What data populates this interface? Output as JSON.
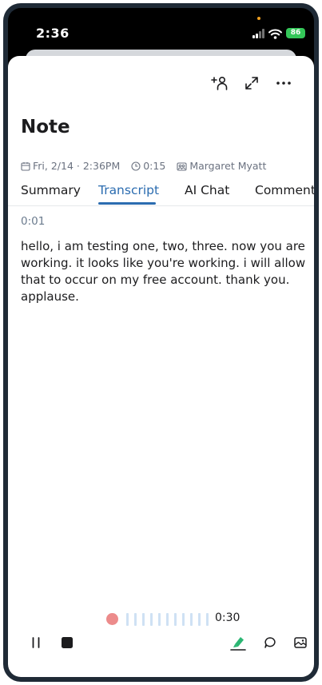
{
  "status_bar": {
    "time": "2:36",
    "battery": "86"
  },
  "note": {
    "title": "Note",
    "date": "Fri, 2/14 · 2:36PM",
    "duration": "0:15",
    "owner": "Margaret Myatt"
  },
  "tabs": [
    {
      "label": "Summary"
    },
    {
      "label": "Transcript"
    },
    {
      "label": "AI Chat"
    },
    {
      "label": "Comments"
    }
  ],
  "active_tab": "Transcript",
  "transcript": {
    "timestamp": "0:01",
    "text": "hello, i am testing one, two, three. now you are working. it looks like you're working. i will allow that to occur on my free account. thank you. applause."
  },
  "recorder": {
    "elapsed": "0:30"
  },
  "colors": {
    "accent": "#2b6cb0",
    "record": "#ec8b8b",
    "highlight": "#2bb673",
    "battery": "#34c759"
  },
  "icons": {
    "add_person": "add-person-icon",
    "expand": "expand-icon",
    "more": "more-icon",
    "calendar": "calendar-icon",
    "clock": "clock-icon",
    "people": "people-icon",
    "pause": "pause-icon",
    "stop": "stop-icon",
    "highlight": "highlighter-icon",
    "comment": "comment-icon",
    "image": "image-icon"
  }
}
